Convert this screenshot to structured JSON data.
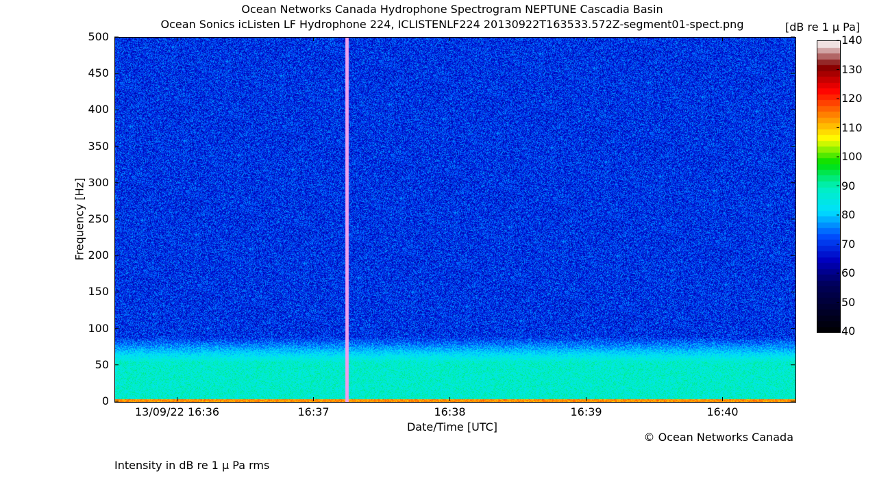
{
  "title": "Ocean Networks Canada Hydrophone Spectrogram NEPTUNE Cascadia Basin",
  "subtitle": "Ocean Sonics icListen LF Hydrophone 224, ICLISTENLF224 20130922T163533.572Z-segment01-spect.png",
  "colorbar_title": "[dB re 1 μ Pa]",
  "copyright": "© Ocean Networks Canada",
  "footnote": "Intensity in dB re 1 μ Pa rms",
  "chart_data": {
    "type": "heatmap",
    "title": "Ocean Networks Canada Hydrophone Spectrogram NEPTUNE Cascadia Basin",
    "subtitle": "Ocean Sonics icListen LF Hydrophone 224, ICLISTENLF224 20130922T163533.572Z-segment01-spect.png",
    "xlabel": "Date/Time [UTC]",
    "ylabel": "Frequency [Hz]",
    "x_ticks": [
      {
        "t": 0,
        "label": "13/09/22 16:36"
      },
      {
        "t": 1,
        "label": "16:37"
      },
      {
        "t": 2,
        "label": "16:38"
      },
      {
        "t": 3,
        "label": "16:39"
      },
      {
        "t": 4,
        "label": "16:40"
      }
    ],
    "xlim": [
      -0.46,
      4.53
    ],
    "y_ticks": [
      0,
      50,
      100,
      150,
      200,
      250,
      300,
      350,
      400,
      450,
      500
    ],
    "ylim": [
      0,
      500
    ],
    "colorbar": {
      "label": "[dB re 1 μ Pa]",
      "ticks": [
        40,
        50,
        60,
        70,
        80,
        90,
        100,
        110,
        120,
        130,
        140
      ],
      "range": [
        40,
        140
      ],
      "colors": [
        "#000000",
        "#00002e",
        "#00005a",
        "#0000c0",
        "#0050ff",
        "#00e0ff",
        "#00f0c0",
        "#00e000",
        "#ffff00",
        "#ff8000",
        "#ff0000",
        "#800000",
        "#ffffff"
      ]
    },
    "features": {
      "broadband_transient_at": 1.24,
      "background_level_db": 70,
      "low_frequency_band_hz": [
        0,
        90
      ],
      "low_frequency_level_db": 88
    },
    "grid": false
  }
}
